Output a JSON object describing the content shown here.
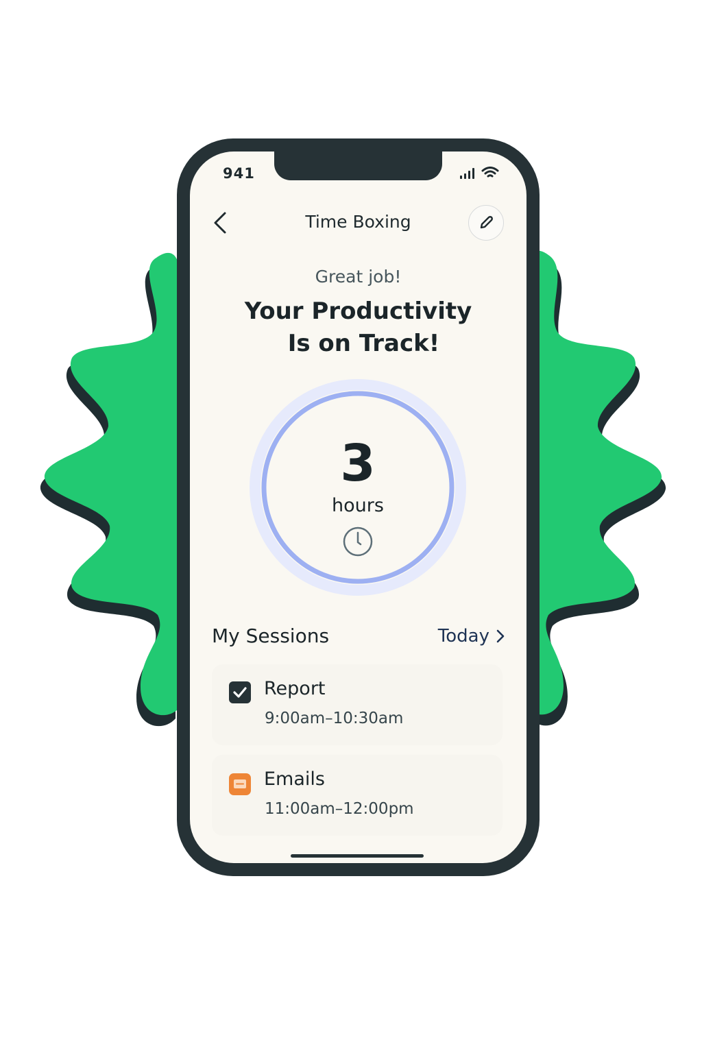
{
  "status_bar": {
    "time": "941",
    "icons": [
      "signal-icon",
      "wifi-icon"
    ]
  },
  "header": {
    "title": "Time Boxing",
    "back_icon": "chevron-left-icon",
    "edit_icon": "pencil-icon"
  },
  "hero": {
    "greeting": "Great job!",
    "headline_line1": "Your Productivity",
    "headline_line2": "Is on Track!"
  },
  "summary": {
    "value": "3",
    "unit": "hours",
    "icon": "clock-icon"
  },
  "sessions": {
    "title": "My Sessions",
    "filter_label": "Today",
    "items": [
      {
        "name": "Report",
        "time": "9:00am–10:30am",
        "icon": "checkbox-checked-icon",
        "color": "#263236"
      },
      {
        "name": "Emails",
        "time": "11:00am–12:00pm",
        "icon": "email-icon",
        "color": "#ee8536"
      }
    ]
  },
  "colors": {
    "accent_green": "#22c972",
    "phone_frame": "#263236",
    "ring_blue": "#9db0f2",
    "ring_halo": "#e4e9fc",
    "screen_bg": "#faf8f2"
  }
}
